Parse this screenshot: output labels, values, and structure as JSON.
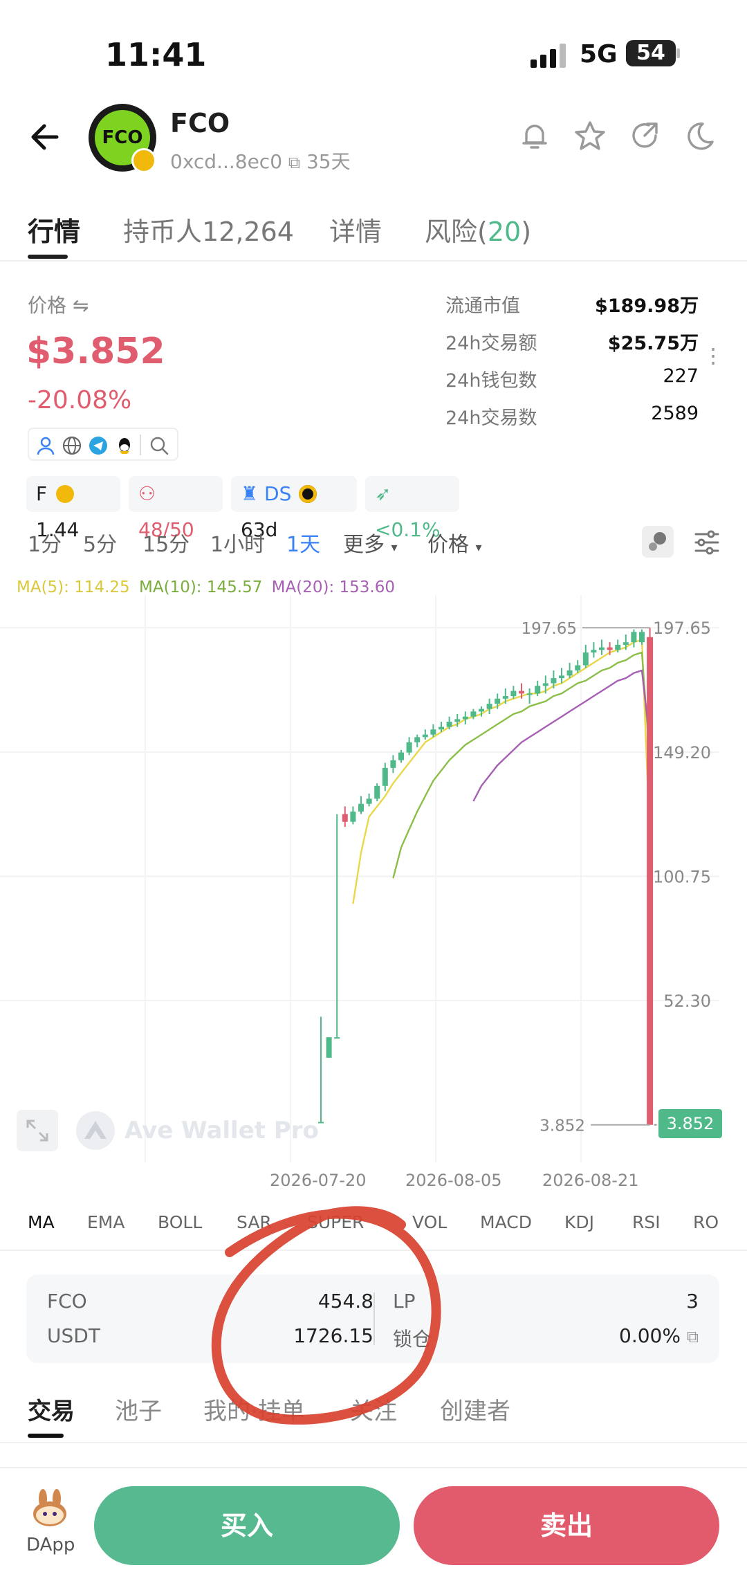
{
  "status": {
    "time": "11:41",
    "network": "5G",
    "battery": "54"
  },
  "token": {
    "name": "FCO",
    "logo_text": "FCO",
    "address": "0xcd...8ec0",
    "age": "35天"
  },
  "header_icons": [
    "bell-icon",
    "star-icon",
    "share-icon",
    "moon-icon"
  ],
  "tabs": [
    {
      "label": "行情"
    },
    {
      "label": "持币人12,264"
    },
    {
      "label": "详情"
    },
    {
      "label": "风险(20)",
      "base": "风险(",
      "count": "20",
      "close": ")"
    }
  ],
  "price": {
    "label": "价格 ⇋",
    "value": "$3.852",
    "change": "-20.08%"
  },
  "stats": [
    {
      "label": "流通市值",
      "value": "$189.98万"
    },
    {
      "label": "24h交易额",
      "value": "$25.75万"
    },
    {
      "label": "24h钱包数",
      "value": "227"
    },
    {
      "label": "24h交易数",
      "value": "2589"
    }
  ],
  "pills": {
    "f_label": "F",
    "f_value": "1.44",
    "holders": "48/50",
    "ds_label": "DS",
    "ds_days": "63d",
    "tax": "<0.1%"
  },
  "timeframes": [
    "1分",
    "5分",
    "15分",
    "1小时",
    "1天",
    "更多",
    "价格"
  ],
  "ma_legend": {
    "ma5": "MA(5): 114.25",
    "ma10": "MA(10): 145.57",
    "ma20": "MA(20): 153.60"
  },
  "chart_data": {
    "type": "candlestick",
    "y_axis_labels": [
      "197.65",
      "149.20",
      "100.75",
      "52.30"
    ],
    "ylim": [
      0,
      205
    ],
    "high_label": "197.65",
    "low_label": "3.852",
    "last_price_tag": "3.852",
    "x_tick_labels": [
      "2026-07-20",
      "2026-08-05",
      "2026-08-21"
    ],
    "watermark": "Ave Wallet Pro",
    "candles": [
      [
        5,
        5,
        5,
        46
      ],
      [
        30,
        38,
        30,
        38
      ],
      [
        38,
        38,
        38,
        125
      ],
      [
        125,
        122,
        120,
        128
      ],
      [
        122,
        126,
        121,
        128
      ],
      [
        126,
        129,
        125,
        132
      ],
      [
        129,
        131,
        128,
        133
      ],
      [
        131,
        136,
        130,
        137
      ],
      [
        136,
        143,
        134,
        145
      ],
      [
        143,
        146,
        141,
        148
      ],
      [
        146,
        149,
        145,
        150
      ],
      [
        149,
        153,
        148,
        155
      ],
      [
        153,
        155,
        151,
        156
      ],
      [
        155,
        156,
        154,
        158
      ],
      [
        156,
        158,
        155,
        160
      ],
      [
        158,
        159,
        157,
        161
      ],
      [
        159,
        161,
        158,
        163
      ],
      [
        161,
        162,
        159,
        164
      ],
      [
        162,
        163,
        160,
        165
      ],
      [
        163,
        165,
        162,
        166
      ],
      [
        165,
        166,
        163,
        167
      ],
      [
        166,
        168,
        164,
        170
      ],
      [
        168,
        170,
        166,
        172
      ],
      [
        170,
        171,
        168,
        174
      ],
      [
        171,
        173,
        170,
        175
      ],
      [
        173,
        172,
        170,
        176
      ],
      [
        172,
        172,
        168,
        174
      ],
      [
        172,
        175,
        171,
        177
      ],
      [
        175,
        176,
        172,
        179
      ],
      [
        176,
        178,
        174,
        181
      ],
      [
        178,
        179,
        176,
        182
      ],
      [
        179,
        181,
        178,
        184
      ],
      [
        181,
        183,
        180,
        185
      ],
      [
        183,
        188,
        182,
        191
      ],
      [
        188,
        189,
        186,
        192
      ],
      [
        189,
        190,
        187,
        193
      ],
      [
        190,
        189,
        187,
        192
      ],
      [
        189,
        191,
        188,
        193
      ],
      [
        191,
        192,
        189,
        195
      ],
      [
        192,
        196,
        190,
        197
      ],
      [
        192,
        196,
        191,
        197
      ],
      [
        194,
        3.852,
        3.852,
        197.65
      ]
    ],
    "ma5": [
      null,
      null,
      null,
      null,
      90,
      110,
      124,
      128,
      132,
      137,
      141,
      145,
      149,
      153,
      155,
      157,
      159,
      160,
      162,
      163,
      164,
      166,
      167,
      169,
      170,
      171,
      172,
      172,
      173,
      175,
      176,
      178,
      180,
      182,
      184,
      186,
      188,
      189,
      190,
      192,
      193,
      114.25
    ],
    "ma10": [
      null,
      null,
      null,
      null,
      null,
      null,
      null,
      null,
      null,
      100,
      112,
      119,
      126,
      132,
      138,
      142,
      146,
      149,
      152,
      154,
      156,
      158,
      160,
      162,
      164,
      165,
      167,
      168,
      169,
      171,
      172,
      174,
      176,
      177,
      179,
      181,
      182,
      184,
      185,
      187,
      188,
      145.57
    ],
    "ma20": [
      null,
      null,
      null,
      null,
      null,
      null,
      null,
      null,
      null,
      null,
      null,
      null,
      null,
      null,
      null,
      null,
      null,
      null,
      null,
      130,
      136,
      140,
      144,
      147,
      150,
      153,
      155,
      157,
      159,
      161,
      163,
      165,
      167,
      169,
      171,
      173,
      175,
      177,
      178,
      180,
      181,
      153.6
    ]
  },
  "indicators": [
    "MA",
    "EMA",
    "BOLL",
    "SAR",
    "SUPER",
    "VOL",
    "MACD",
    "KDJ",
    "RSI",
    "RO"
  ],
  "pool": {
    "token_label": "FCO",
    "token_amount": "454.8",
    "quote_label": "USDT",
    "quote_amount": "1726.15",
    "lp_label": "LP",
    "lp_value": "3",
    "lock_label": "锁仓",
    "lock_value": "0.00%"
  },
  "bottom_tabs": [
    "交易",
    "池子",
    "我的·挂单",
    "关注",
    "创建者"
  ],
  "dapp_label": "DApp",
  "buy_label": "买入",
  "sell_label": "卖出",
  "colors": {
    "up": "#4fb98a",
    "down": "#e05d6f",
    "ma5": "#e8d84a",
    "ma10": "#8cbf4a",
    "ma20": "#a75fb4",
    "annotation": "#d8412f"
  }
}
